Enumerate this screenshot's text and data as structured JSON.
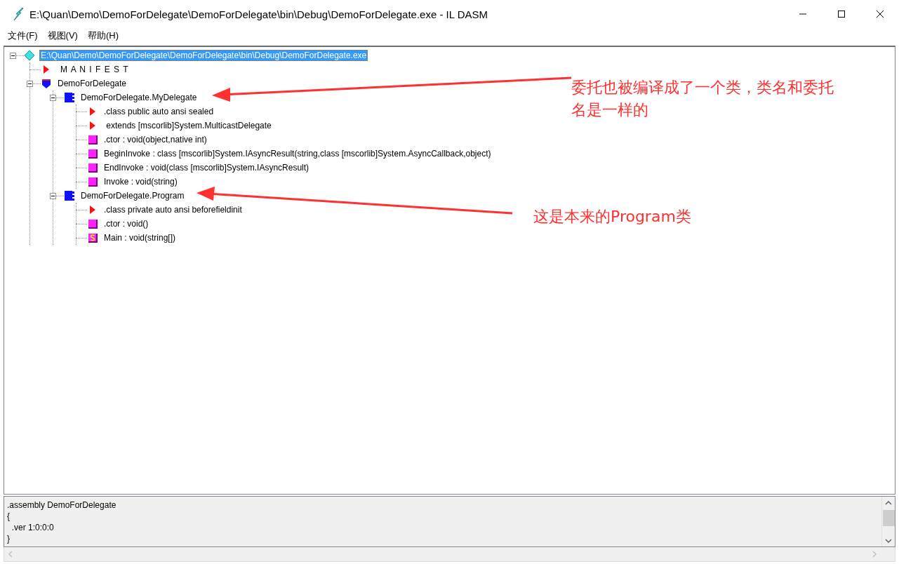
{
  "window": {
    "title": "E:\\Quan\\Demo\\DemoForDelegate\\DemoForDelegate\\bin\\Debug\\DemoForDelegate.exe - IL DASM"
  },
  "menu": [
    "文件(F)",
    "视图(V)",
    "帮助(H)"
  ],
  "tree": [
    {
      "kind": "root",
      "label": "E:\\Quan\\Demo\\DemoForDelegate\\DemoForDelegate\\bin\\Debug\\DemoForDelegate.exe",
      "selected": true,
      "expanded": true,
      "children": [
        {
          "kind": "manifest",
          "label": "M A N I F E S T",
          "selected": false
        },
        {
          "kind": "namespace",
          "label": "DemoForDelegate",
          "selected": false,
          "expanded": true,
          "children": [
            {
              "kind": "class",
              "label": "DemoForDelegate.MyDelegate",
              "selected": false,
              "expanded": true,
              "children": [
                {
                  "kind": "info",
                  "label": ".class public auto ansi sealed",
                  "selected": false
                },
                {
                  "kind": "info",
                  "label": " extends [mscorlib]System.MulticastDelegate",
                  "selected": false
                },
                {
                  "kind": "method",
                  "label": ".ctor : void(object,native int)",
                  "selected": false
                },
                {
                  "kind": "method",
                  "label": "BeginInvoke : class [mscorlib]System.IAsyncResult(string,class [mscorlib]System.AsyncCallback,object)",
                  "selected": false
                },
                {
                  "kind": "method",
                  "label": "EndInvoke : void(class [mscorlib]System.IAsyncResult)",
                  "selected": false
                },
                {
                  "kind": "method",
                  "label": "Invoke : void(string)",
                  "selected": false
                }
              ]
            },
            {
              "kind": "class",
              "label": "DemoForDelegate.Program",
              "selected": false,
              "expanded": true,
              "children": [
                {
                  "kind": "info",
                  "label": ".class private auto ansi beforefieldinit",
                  "selected": false
                },
                {
                  "kind": "method",
                  "label": ".ctor : void()",
                  "selected": false
                },
                {
                  "kind": "static",
                  "label": "Main : void(string[])",
                  "selected": false
                }
              ]
            }
          ]
        }
      ]
    }
  ],
  "annotations": [
    "委托也被编译成了一个类，类名和委托名是一样的",
    "这是本来的Program类"
  ],
  "details": [
    ".assembly DemoForDelegate",
    "{",
    "  .ver 1:0:0:0",
    "}"
  ]
}
